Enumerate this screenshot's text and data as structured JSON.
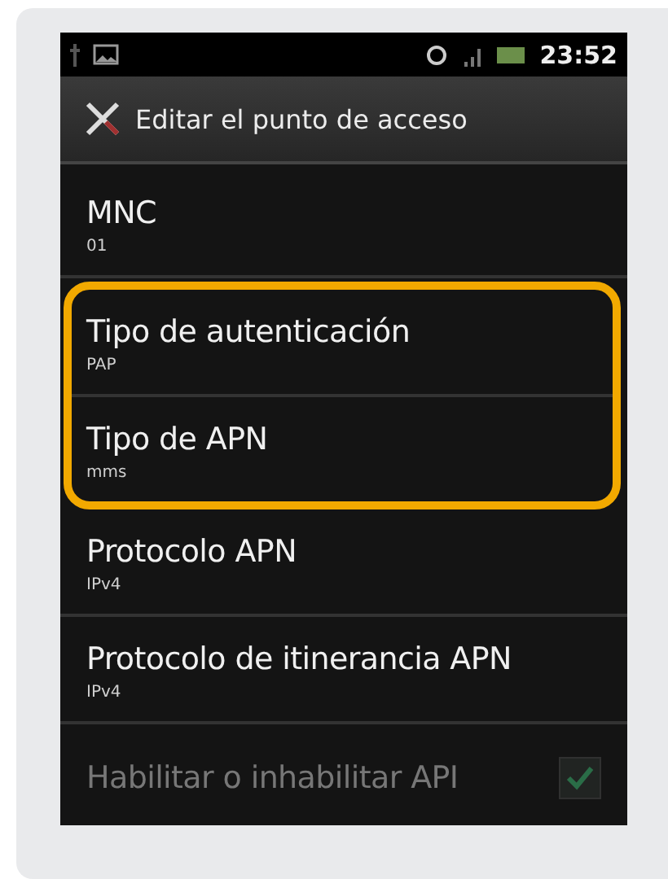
{
  "status_bar": {
    "time": "23:52"
  },
  "action_bar": {
    "title": "Editar el punto de acceso"
  },
  "items": [
    {
      "kind": "text",
      "title": "MNC",
      "summary": "01",
      "highlighted": false,
      "disabled": false
    },
    {
      "kind": "text",
      "title": "Tipo de autenticación",
      "summary": "PAP",
      "highlighted": true,
      "disabled": false
    },
    {
      "kind": "text",
      "title": "Tipo de APN",
      "summary": "mms",
      "highlighted": true,
      "disabled": false
    },
    {
      "kind": "text",
      "title": "Protocolo APN",
      "summary": "IPv4",
      "highlighted": false,
      "disabled": false
    },
    {
      "kind": "text",
      "title": "Protocolo de itinerancia APN",
      "summary": "IPv4",
      "highlighted": false,
      "disabled": false
    },
    {
      "kind": "checkbox",
      "title": "Habilitar o inhabilitar API",
      "checked": true,
      "highlighted": false,
      "disabled": true
    }
  ]
}
